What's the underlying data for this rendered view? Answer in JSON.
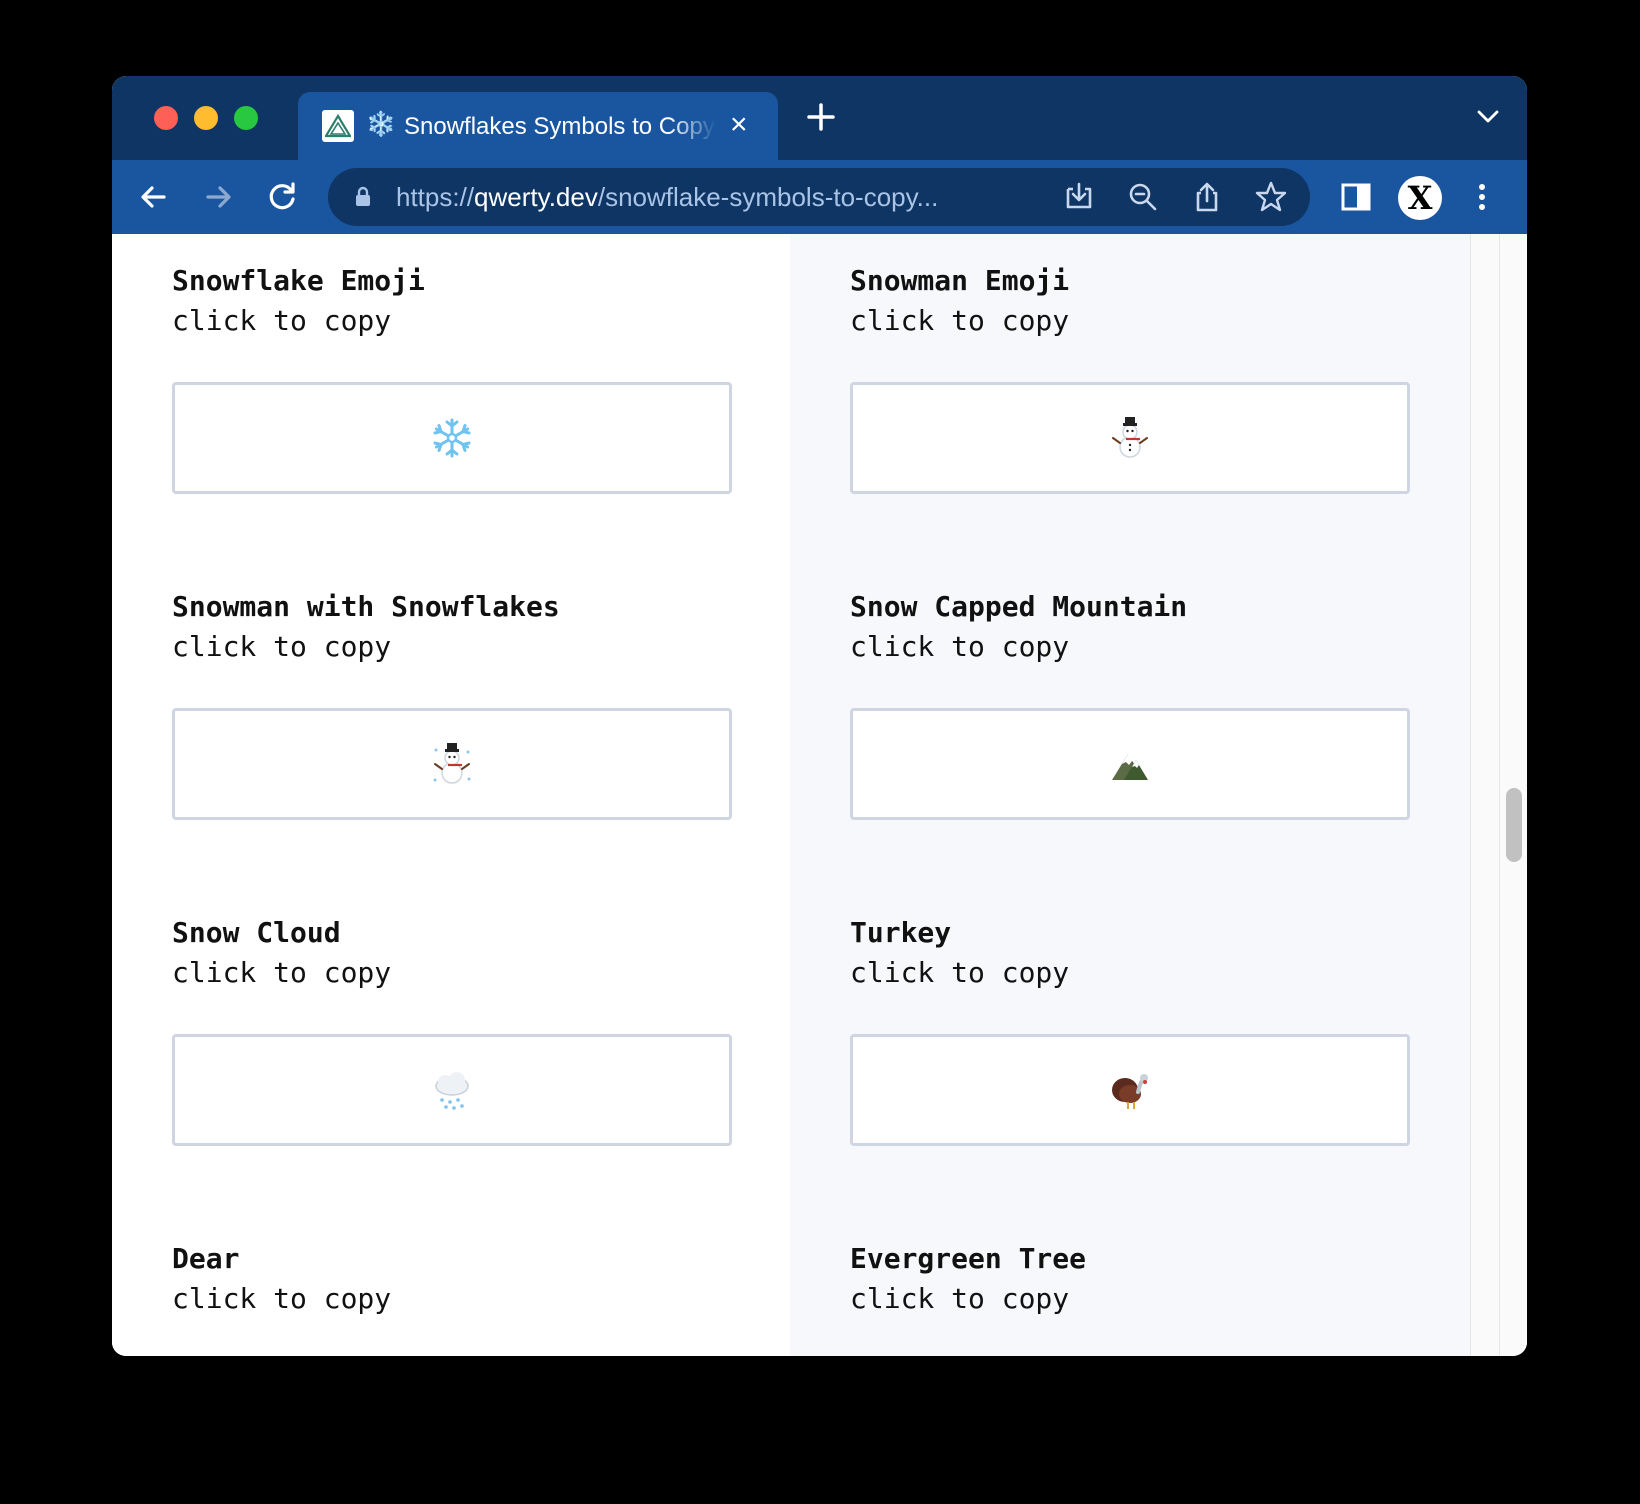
{
  "browser": {
    "tab_title": "Snowflakes Symbols to Copy",
    "tab_emoji": "❄️",
    "url_scheme": "https://",
    "url_host": "qwerty.dev",
    "url_path": "/snowflake-symbols-to-copy...",
    "avatar_letter": "X"
  },
  "icons": {
    "back": "back-arrow-icon",
    "forward": "forward-arrow-icon",
    "reload": "reload-icon",
    "lock": "lock-icon",
    "install": "install-app-icon",
    "zoom": "zoom-out-icon",
    "share": "share-icon",
    "star": "bookmark-star-icon",
    "sidepanel": "side-panel-icon",
    "menu": "kebab-menu-icon"
  },
  "cards": [
    {
      "title": "Snowflake Emoji",
      "subtitle": "click to copy",
      "symbol": "snowflake"
    },
    {
      "title": "Snowman Emoji",
      "subtitle": "click to copy",
      "symbol": "snowman"
    },
    {
      "title": "Snowman with Snowflakes",
      "subtitle": "click to copy",
      "symbol": "snowman-with-snow"
    },
    {
      "title": "Snow Capped Mountain",
      "subtitle": "click to copy",
      "symbol": "snow-capped-mountain"
    },
    {
      "title": "Snow Cloud",
      "subtitle": "click to copy",
      "symbol": "snow-cloud"
    },
    {
      "title": "Turkey",
      "subtitle": "click to copy",
      "symbol": "turkey"
    },
    {
      "title": "Dear",
      "subtitle": "click to copy",
      "symbol": ""
    },
    {
      "title": "Evergreen Tree",
      "subtitle": "click to copy",
      "symbol": ""
    }
  ],
  "colors": {
    "tabbar": "#0e3563",
    "toolbar": "#1a56a0",
    "right_column": "#f6f8fb",
    "box_border": "#cfd6e2"
  }
}
